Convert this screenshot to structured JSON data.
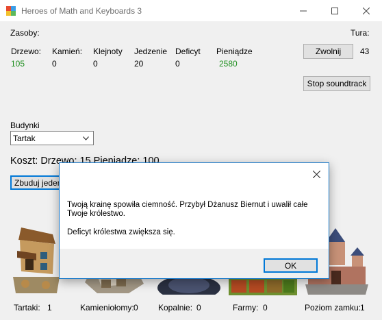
{
  "window": {
    "title": "Heroes of Math and Keyboards 3",
    "minimize_icon": "minimize-icon",
    "maximize_icon": "maximize-icon",
    "close_icon": "close-icon"
  },
  "resources": {
    "header": "Zasoby:",
    "columns": [
      {
        "label": "Drzewo:",
        "value": "105"
      },
      {
        "label": "Kamień:",
        "value": "0"
      },
      {
        "label": "Klejnoty",
        "value": "0"
      },
      {
        "label": "Jedzenie",
        "value": "20"
      },
      {
        "label": "Deficyt",
        "value": "0"
      },
      {
        "label": "Pieniądze",
        "value": "2580"
      }
    ],
    "highlight_color": "#1f8f1f"
  },
  "turn": {
    "label": "Tura:",
    "value": "43",
    "end_turn_button": "Zwolnij",
    "stop_soundtrack_button": "Stop soundtrack"
  },
  "buildings": {
    "label": "Budynki",
    "selected": "Tartak",
    "cost_text": "Koszt: Drzewo: 15   Pieniądze: 100",
    "build_button": "Zbuduj jeden"
  },
  "stats": [
    {
      "label": "Tartaki:",
      "value": "1"
    },
    {
      "label": "Kamieniołomy:",
      "value": "0"
    },
    {
      "label": "Kopalnie:",
      "value": "0"
    },
    {
      "label": "Farmy:",
      "value": "0"
    },
    {
      "label": "Poziom zamku:",
      "value": "1"
    }
  ],
  "dialog": {
    "message_line1": "Twoją krainę spowiła ciemność. Przybył Dżanusz Biernut i uwalił całe",
    "message_line2": "Twoje królestwo.",
    "message_line3": "Deficyt królestwa zwiększa się.",
    "ok_button": "OK",
    "close_icon": "close-icon"
  },
  "colors": {
    "dialog_border": "#1979ca",
    "focus_border": "#0078d7"
  }
}
